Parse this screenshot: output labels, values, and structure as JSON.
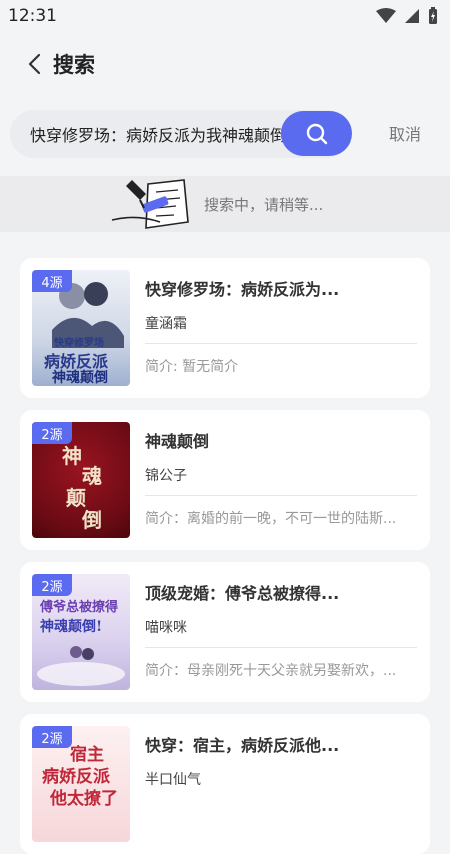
{
  "status_bar": {
    "time": "12:31"
  },
  "header": {
    "title": "搜索"
  },
  "search": {
    "query": "快穿修罗场：病娇反派为我神魂颠倒",
    "cancel_label": "取消"
  },
  "loading": {
    "text": "搜索中，请稍等..."
  },
  "results": [
    {
      "source": "4源",
      "title": "快穿修罗场：病娇反派为...",
      "author": "童涵霜",
      "intro": "简介: 暂无简介",
      "cover_text": [
        "快穿修罗场",
        "病娇反派",
        "神魂颠倒"
      ],
      "cover_color": "#dfe6f2"
    },
    {
      "source": "2源",
      "title": "神魂颠倒",
      "author": "锦公子",
      "intro": "简介：离婚的前一晚，不可一世的陆斯...",
      "cover_text": [
        "神",
        "魂",
        "颠",
        "倒"
      ],
      "cover_color": "#7a0f18"
    },
    {
      "source": "2源",
      "title": "顶级宠婚：傅爷总被撩得...",
      "author": "喵咪咪",
      "intro": "简介：母亲刚死十天父亲就另娶新欢，...",
      "cover_text": [
        "傅爷总被撩得",
        "神魂颠倒!"
      ],
      "cover_color": "#e9e4f4"
    },
    {
      "source": "2源",
      "title": "快穿：宿主，病娇反派他...",
      "author": "半口仙气",
      "intro": "",
      "cover_text": [
        "宿主",
        "病娇反派",
        "他太撩了"
      ],
      "cover_color": "#fbe9ea"
    }
  ],
  "colors": {
    "accent": "#5b6bf0",
    "background": "#f3f4f6",
    "card": "#ffffff"
  }
}
